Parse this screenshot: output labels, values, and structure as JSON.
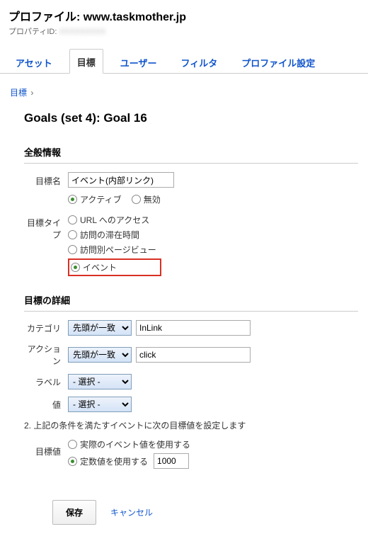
{
  "header": {
    "profile_label": "プロファイル:",
    "profile_value": "www.taskmother.jp",
    "property_id_label": "プロパティID:",
    "property_id_value": "XXXXXXXXX"
  },
  "tabs": {
    "asset": "アセット",
    "goal": "目標",
    "user": "ユーザー",
    "filter": "フィルタ",
    "profile_settings": "プロファイル設定"
  },
  "breadcrumb": {
    "goal": "目標",
    "sep": "›"
  },
  "page_title": "Goals (set 4): Goal 16",
  "general": {
    "section_title": "全般情報",
    "name_label": "目標名",
    "name_value": "イベント(内部リンク)",
    "status_active": "アクティブ",
    "status_disabled": "無効",
    "type_label": "目標タイプ",
    "type_url": "URL へのアクセス",
    "type_duration": "訪問の滞在時間",
    "type_pageview": "訪問別ページビュー",
    "type_event": "イベント"
  },
  "details": {
    "section_title": "目標の詳細",
    "category_label": "カテゴリ",
    "action_label": "アクション",
    "label_label": "ラベル",
    "value_label": "値",
    "match_beginswith": "先頭が一致",
    "match_select": "- 選択 -",
    "category_value": "InLink",
    "action_value": "click",
    "step2_text": "2. 上記の条件を満たすイベントに次の目標値を設定します",
    "goal_value_label": "目標値",
    "use_actual": "実際のイベント値を使用する",
    "use_fixed": "定数値を使用する",
    "fixed_value": "1000"
  },
  "buttons": {
    "save": "保存",
    "cancel": "キャンセル"
  }
}
